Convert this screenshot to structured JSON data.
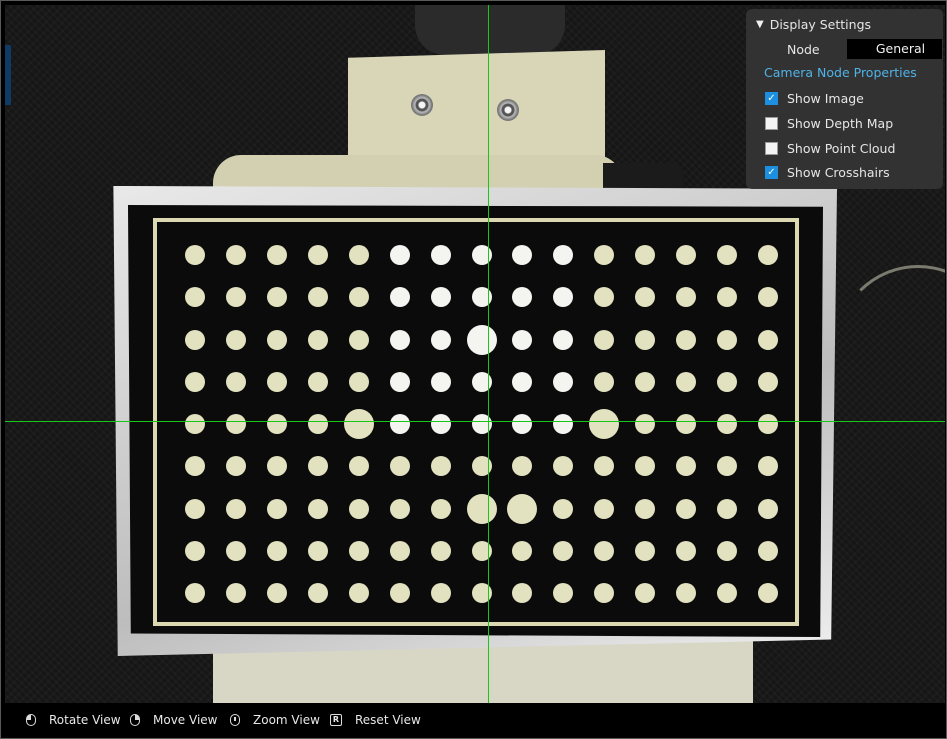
{
  "display_settings": {
    "title": "Display Settings",
    "node_label": "Node",
    "node_value": "General",
    "properties_link": "Camera Node Properties",
    "options": [
      {
        "label": "Show Image",
        "checked": true
      },
      {
        "label": "Show Depth Map",
        "checked": false
      },
      {
        "label": "Show Point Cloud",
        "checked": false
      },
      {
        "label": "Show Crosshairs",
        "checked": true
      }
    ]
  },
  "controls": [
    {
      "label": "Rotate View",
      "icon": "mouse-left-icon"
    },
    {
      "label": "Move View",
      "icon": "mouse-right-icon"
    },
    {
      "label": "Zoom View",
      "icon": "mouse-wheel-icon"
    },
    {
      "label": "Reset View",
      "icon": "r-key-icon",
      "key": "R"
    }
  ],
  "colors": {
    "crosshair": "#18c818",
    "checkbox_checked": "#1d8fe0",
    "link": "#4fb3e8",
    "panel_bg": "#343434"
  }
}
